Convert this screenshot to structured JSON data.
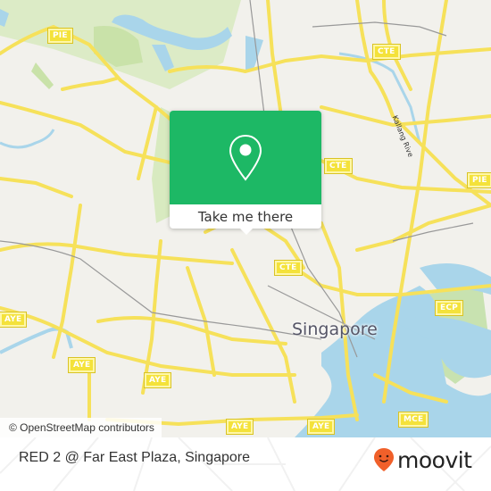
{
  "map": {
    "city_label": "Singapore",
    "river_label": "Kallang Rive",
    "attribution": "© OpenStreetMap contributors",
    "road_shields": [
      {
        "id": "pie-nw",
        "label": "PIE"
      },
      {
        "id": "cte-n",
        "label": "CTE"
      },
      {
        "id": "cte-mid",
        "label": "CTE"
      },
      {
        "id": "pie-e",
        "label": "PIE"
      },
      {
        "id": "cte-s",
        "label": "CTE"
      },
      {
        "id": "ecp",
        "label": "ECP"
      },
      {
        "id": "aye-w",
        "label": "AYE"
      },
      {
        "id": "aye-1",
        "label": "AYE"
      },
      {
        "id": "aye-2",
        "label": "AYE"
      },
      {
        "id": "aye-3",
        "label": "AYE"
      },
      {
        "id": "aye-4",
        "label": "AYE"
      },
      {
        "id": "mce",
        "label": "MCE"
      }
    ],
    "colors": {
      "land": "#f2f1ec",
      "water": "#a9d5ea",
      "park": "#d3e8b8",
      "motorway": "#f6e15a"
    }
  },
  "popup": {
    "icon": "map-pin-icon",
    "button_label": "Take me there",
    "accent": "#1db865"
  },
  "footer": {
    "place_name": "RED 2 @ Far East Plaza, Singapore",
    "brand": "moovit",
    "brand_color": "#f0602a"
  }
}
